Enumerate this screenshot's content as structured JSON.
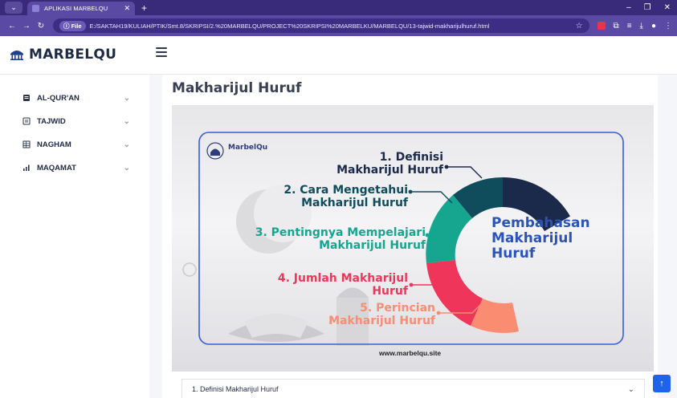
{
  "browser": {
    "tab_title": "APLIKASI MARBELQU",
    "new_tab": "+",
    "url_scheme": "File",
    "url": "E:/SAKTAH19/KULIAH/PTIK/Smt.8/SKRIPSI/2.%20MARBELQU/PROJECT%20SKRIPSI%20MARBELKU/MARBELQU/13-tajwid-makharijulhuruf.html"
  },
  "app": {
    "brand": "MARBELQU",
    "page_title": "Makharijul Huruf"
  },
  "sidebar": {
    "items": [
      {
        "label": "AL-QUR'AN",
        "icon": "book-icon"
      },
      {
        "label": "TAJWID",
        "icon": "document-icon"
      },
      {
        "label": "NAGHAM",
        "icon": "table-icon"
      },
      {
        "label": "MAQAMAT",
        "icon": "bar-chart-icon"
      }
    ]
  },
  "hero": {
    "logo_text": "MarbelQu",
    "items": [
      {
        "number": "1.",
        "text_line1": "Definisi",
        "text_line2": "Makharijul Huruf",
        "color": "#1b2a4a"
      },
      {
        "number": "2.",
        "text_line1": "Cara Mengetahui",
        "text_line2": "Makharijul Huruf",
        "color": "#0f4c5c"
      },
      {
        "number": "3.",
        "text_line1": "Pentingnya Mempelajari",
        "text_line2": "Makharijul Huruf",
        "color": "#16a58f"
      },
      {
        "number": "4.",
        "text_line1": "Jumlah Makharijul",
        "text_line2": "Huruf",
        "color": "#f0355a"
      },
      {
        "number": "5.",
        "text_line1": "Perincian",
        "text_line2": "Makharijul Huruf",
        "color": "#fa8c72"
      }
    ],
    "center_title_line1": "Pembahasan",
    "center_title_line2": "Makharijul",
    "center_title_line3": "Huruf",
    "website": "www.marbelqu.site"
  },
  "accordion": {
    "label": "1. Definisi Makharijul Huruf"
  },
  "colors": {
    "browser_accent": "#5b4aa4",
    "hero_frame": "#3b5bd8",
    "to_top_button": "#1e63e9"
  }
}
